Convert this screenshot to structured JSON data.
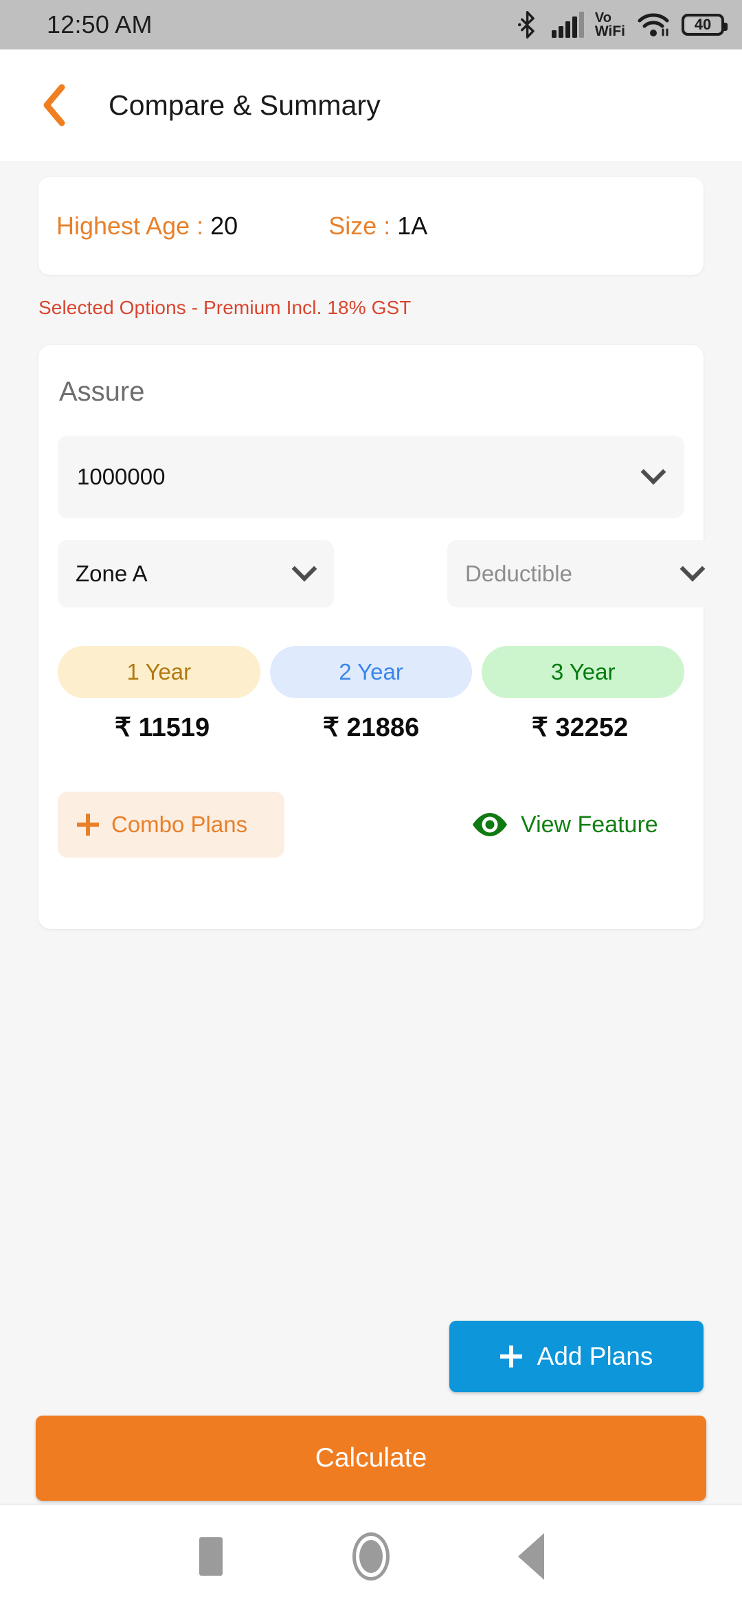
{
  "status_bar": {
    "time": "12:50 AM",
    "bluetooth_icon": "bluetooth-icon",
    "signal_icon": "cellular-signal-icon",
    "vo_line1": "Vo",
    "vo_line2": "WiFi",
    "wifi_icon": "wifi-icon",
    "battery_level": "40"
  },
  "header": {
    "back_icon": "chevron-left-icon",
    "title": "Compare & Summary"
  },
  "info_card": {
    "age_label": "Highest Age : ",
    "age_value": "20",
    "size_label": "Size : ",
    "size_value": "1A"
  },
  "gst_note": "Selected Options - Premium Incl. 18% GST",
  "plan_card": {
    "name": "Assure",
    "sum_insured": {
      "value": "1000000",
      "chevron_icon": "chevron-down-icon"
    },
    "zone": {
      "value": "Zone A",
      "chevron_icon": "chevron-down-icon"
    },
    "deductible": {
      "placeholder": "Deductible",
      "chevron_icon": "chevron-down-icon"
    },
    "tenures": [
      {
        "label": "1 Year",
        "price": "₹ 11519"
      },
      {
        "label": "2 Year",
        "price": "₹ 21886"
      },
      {
        "label": "3 Year",
        "price": "₹ 32252"
      }
    ],
    "combo_plans_label": "Combo Plans",
    "combo_plans_icon": "plus-icon",
    "view_feature_label": "View Feature",
    "view_feature_icon": "eye-icon"
  },
  "actions": {
    "add_plans_label": "Add Plans",
    "add_plans_icon": "plus-icon",
    "calculate_label": "Calculate"
  },
  "nav_bar": {
    "recents_icon": "square-recents-icon",
    "home_icon": "circle-home-icon",
    "back_icon": "triangle-back-icon"
  },
  "colors": {
    "accent_orange": "#e8802a",
    "calculate_orange": "#f07c22",
    "add_plans_blue": "#0d96da",
    "gst_red": "#d9452f",
    "feature_green": "#128012"
  }
}
